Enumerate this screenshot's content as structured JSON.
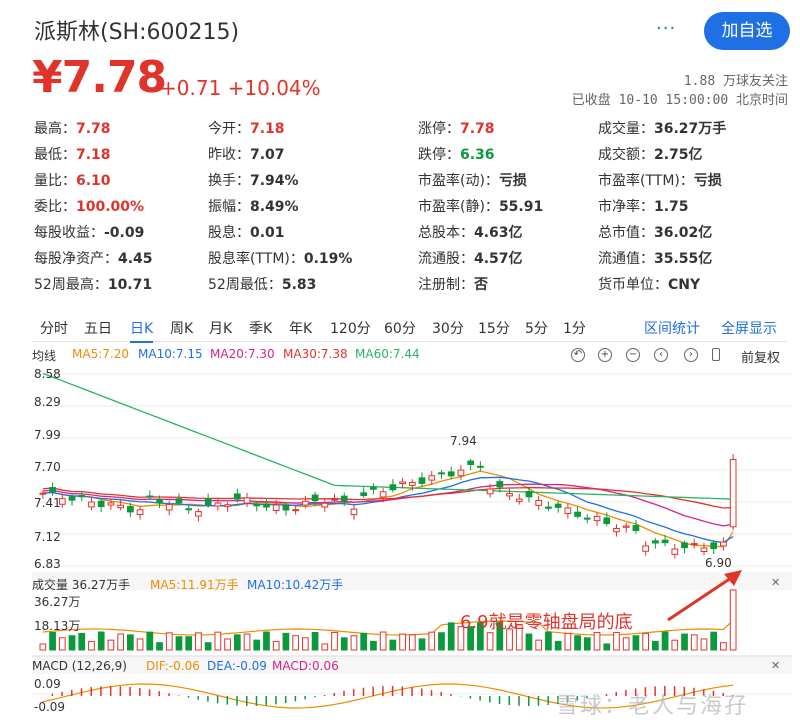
{
  "header": {
    "title": "派斯林(SH:600215)",
    "price": "¥7.78",
    "change": "+0.71 +10.04%",
    "more_label": "···",
    "follow_button": "加自选",
    "followers": "1.88 万球友关注",
    "status": "已收盘 10-10 15:00:00 北京时间"
  },
  "colors": {
    "up": "#e0342b",
    "down": "#0a9a3c",
    "accent": "#1f6fe5"
  },
  "stats": [
    {
      "label": "最高：",
      "value": "7.78",
      "color": "red"
    },
    {
      "label": "今开：",
      "value": "7.18",
      "color": "red"
    },
    {
      "label": "涨停：",
      "value": "7.78",
      "color": "red"
    },
    {
      "label": "成交量：",
      "value": "36.27万手",
      "color": ""
    },
    {
      "label": "最低：",
      "value": "7.18",
      "color": "red"
    },
    {
      "label": "昨收：",
      "value": "7.07",
      "color": ""
    },
    {
      "label": "跌停：",
      "value": "6.36",
      "color": "green"
    },
    {
      "label": "成交额：",
      "value": "2.75亿",
      "color": ""
    },
    {
      "label": "量比：",
      "value": "6.10",
      "color": "red"
    },
    {
      "label": "换手：",
      "value": "7.94%",
      "color": ""
    },
    {
      "label": "市盈率(动)：",
      "value": "亏损",
      "color": ""
    },
    {
      "label": "市盈率(TTM)：",
      "value": "亏损",
      "color": ""
    },
    {
      "label": "委比：",
      "value": "100.00%",
      "color": "red"
    },
    {
      "label": "振幅：",
      "value": "8.49%",
      "color": ""
    },
    {
      "label": "市盈率(静)：",
      "value": "55.91",
      "color": ""
    },
    {
      "label": "市净率：",
      "value": "1.75",
      "color": ""
    },
    {
      "label": "每股收益：",
      "value": "-0.09",
      "color": ""
    },
    {
      "label": "股息：",
      "value": "0.01",
      "color": ""
    },
    {
      "label": "总股本：",
      "value": "4.63亿",
      "color": ""
    },
    {
      "label": "总市值：",
      "value": "36.02亿",
      "color": ""
    },
    {
      "label": "每股净资产：",
      "value": "4.45",
      "color": ""
    },
    {
      "label": "股息率(TTM)：",
      "value": "0.19%",
      "color": ""
    },
    {
      "label": "流通股：",
      "value": "4.57亿",
      "color": ""
    },
    {
      "label": "流通值：",
      "value": "35.55亿",
      "color": ""
    },
    {
      "label": "52周最高：",
      "value": "10.71",
      "color": ""
    },
    {
      "label": "52周最低：",
      "value": "5.83",
      "color": ""
    },
    {
      "label": "注册制：",
      "value": "否",
      "color": ""
    },
    {
      "label": "货币单位：",
      "value": "CNY",
      "color": ""
    }
  ],
  "tabs": [
    "分时",
    "五日",
    "日K",
    "周K",
    "月K",
    "季K",
    "年K",
    "120分",
    "60分",
    "30分",
    "15分",
    "5分",
    "1分"
  ],
  "active_tab": "日K",
  "right_tabs": [
    "区间统计",
    "全屏显示"
  ],
  "legend": {
    "title": "均线",
    "ma5": "MA5:7.20",
    "ma10": "MA10:7.15",
    "ma20": "MA20:7.30",
    "ma30": "MA30:7.38",
    "ma60": "MA60:7.44",
    "adjust": "前复权",
    "ma_colors": {
      "ma5": "#f08c00",
      "ma10": "#1f6fe5",
      "ma20": "#d6238a",
      "ma30": "#e0342b",
      "ma60": "#28b463"
    }
  },
  "chart_data": {
    "type": "candlestick",
    "price_ticks": [
      "8.58",
      "8.29",
      "7.99",
      "7.70",
      "7.41",
      "7.12",
      "6.83"
    ],
    "ylim": [
      6.83,
      8.58
    ],
    "marked_high": "7.94",
    "marked_low": "6.90",
    "last_close": 7.78,
    "volume": {
      "title": "成交量 36.27万手",
      "ma5": "MA5:11.91万手",
      "ma10": "MA10:10.42万手",
      "ticks": [
        "36.27万",
        "18.13万"
      ]
    },
    "macd": {
      "title": "MACD (12,26,9)",
      "dif": "DIF:-0.06",
      "dea": "DEA:-0.09",
      "macd": "MACD:0.06",
      "ticks": [
        "0.09",
        "-0.09"
      ]
    }
  },
  "annotation": "6.9就是零轴盘局的底",
  "watermark": "雪球：老人与海孖"
}
